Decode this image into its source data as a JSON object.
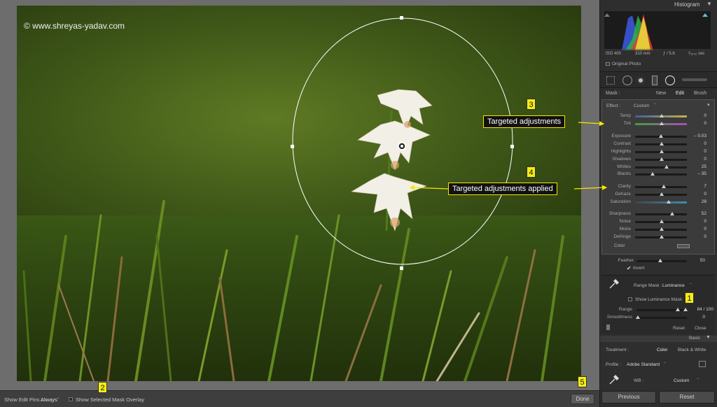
{
  "watermark": "© www.shreyas-yadav.com",
  "bottombar": {
    "show_edit_pins_label": "Show Edit Pins :",
    "show_edit_pins_value": "Always",
    "show_mask_overlay_label": "Show Selected Mask Overlay",
    "done_label": "Done"
  },
  "histogram": {
    "title": "Histogram",
    "iso": "ISO 400",
    "focal": "310 mm",
    "aperture": "ƒ / 5.6",
    "shutter": "¹⁄₁₆₀₀ sec",
    "original_photo": "Original Photo"
  },
  "mask": {
    "label": "Mask :",
    "new": "New",
    "edit": "Edit",
    "brush": "Brush"
  },
  "effect": {
    "label": "Effect :",
    "value": "Custom",
    "sliders": [
      {
        "label": "Temp",
        "value": "0"
      },
      {
        "label": "Tint",
        "value": "0"
      },
      {
        "label": "Exposure",
        "value": "– 0.03"
      },
      {
        "label": "Contrast",
        "value": "0"
      },
      {
        "label": "Highlights",
        "value": "0"
      },
      {
        "label": "Shadows",
        "value": "0"
      },
      {
        "label": "Whites",
        "value": "25"
      },
      {
        "label": "Blacks",
        "value": "– 35"
      },
      {
        "label": "Clarity",
        "value": "7"
      },
      {
        "label": "Dehaze",
        "value": "0"
      },
      {
        "label": "Saturation",
        "value": "28"
      },
      {
        "label": "Sharpness",
        "value": "52"
      },
      {
        "label": "Noise",
        "value": "0"
      },
      {
        "label": "Moire",
        "value": "0"
      },
      {
        "label": "Defringe",
        "value": "0"
      }
    ],
    "color_label": "Color"
  },
  "feather": {
    "label": "Feather",
    "value": "50",
    "invert_label": "Invert"
  },
  "range_mask": {
    "label": "Range Mask :",
    "value": "Luminance",
    "show_label": "Show Luminance Mask",
    "range_label": "Range",
    "range_value": "84 / 100",
    "smoothness_label": "Smoothness",
    "smoothness_value": "0",
    "reset": "Reset",
    "close": "Close"
  },
  "basic": {
    "title": "Basic",
    "treatment_label": "Treatment :",
    "color": "Color",
    "bw": "Black & White",
    "profile_label": "Profile :",
    "profile_value": "Adobe Standard",
    "wb_label": "WB :",
    "wb_value": "Custom"
  },
  "footer": {
    "previous": "Previous",
    "reset": "Reset"
  },
  "callouts": {
    "c3": "Targeted adjustments",
    "c4": "Targeted adjustments applied",
    "n1": "1",
    "n2": "2",
    "n3": "3",
    "n4": "4",
    "n5": "5"
  }
}
